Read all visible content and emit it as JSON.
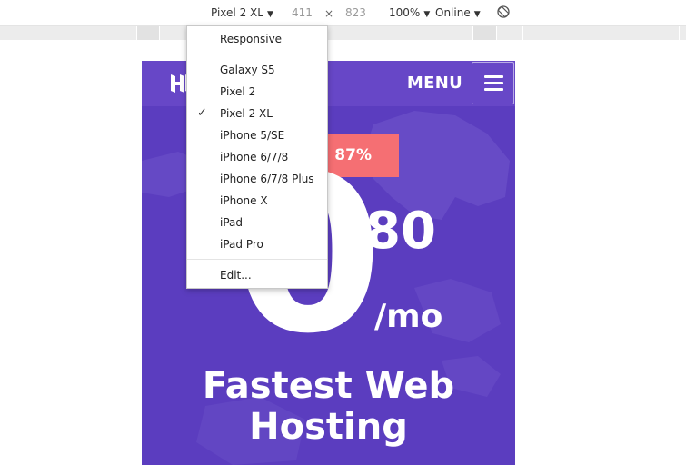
{
  "toolbar": {
    "device": "Pixel 2 XL",
    "width": "411",
    "times": "×",
    "height": "823",
    "zoom": "100%",
    "network": "Online"
  },
  "dropdown": {
    "responsive": "Responsive",
    "devices": [
      "Galaxy S5",
      "Pixel 2",
      "Pixel 2 XL",
      "iPhone 5/SE",
      "iPhone 6/7/8",
      "iPhone 6/7/8 Plus",
      "iPhone X",
      "iPad",
      "iPad Pro"
    ],
    "selected": "Pixel 2 XL",
    "check": "✓",
    "edit": "Edit..."
  },
  "page": {
    "menu_label": "MENU",
    "discount": "87%",
    "price_big": "0",
    "price_cents": "80",
    "price_period": "/mo",
    "title_line1": "Fastest Web",
    "title_line2": "Hosting"
  },
  "colors": {
    "hero_bg": "#5b3dbf",
    "header_bg": "#6747c7",
    "discount_bg": "#f56f73"
  }
}
